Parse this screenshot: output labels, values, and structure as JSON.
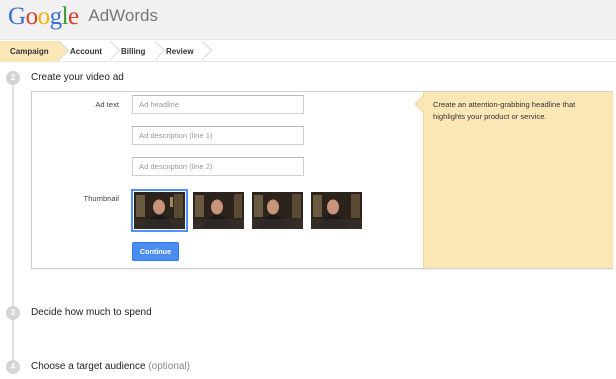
{
  "logo": {
    "google_letters": [
      {
        "char": "G",
        "color": "#3b6fd8"
      },
      {
        "char": "o",
        "color": "#d6402f"
      },
      {
        "char": "o",
        "color": "#f2b705"
      },
      {
        "char": "g",
        "color": "#3b6fd8"
      },
      {
        "char": "l",
        "color": "#3a9a3a"
      },
      {
        "char": "e",
        "color": "#d6402f"
      }
    ],
    "product": "AdWords"
  },
  "breadcrumb": {
    "steps": [
      "Campaign",
      "Account",
      "Billing",
      "Review"
    ],
    "active_index": 0
  },
  "steps": [
    {
      "number": "2",
      "title": "Create your video ad",
      "optional": ""
    },
    {
      "number": "3",
      "title": "Decide how much to spend",
      "optional": ""
    },
    {
      "number": "4",
      "title": "Choose a target audience",
      "optional": "(optional)"
    }
  ],
  "form": {
    "ad_text_label": "Ad text",
    "headline_placeholder": "Ad headline",
    "desc1_placeholder": "Ad description (line 1)",
    "desc2_placeholder": "Ad description (line 2)",
    "thumbnail_label": "Thumbnail",
    "thumbnail_count": 4,
    "selected_thumbnail": 0,
    "continue_label": "Continue"
  },
  "help": {
    "text": "Create an attention-grabbing headline that highlights your product or service."
  },
  "colors": {
    "accent_blue": "#4a8cf0",
    "help_background": "#fbe7b5",
    "active_crumb": "#fbe7b5"
  }
}
